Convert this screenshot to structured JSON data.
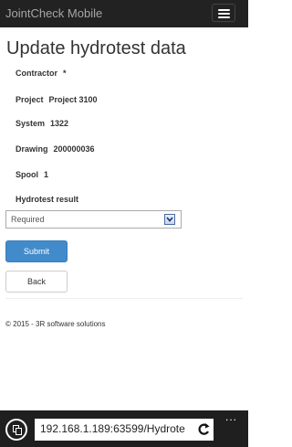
{
  "app": {
    "brand": "JointCheck Mobile"
  },
  "page": {
    "title": "Update hydrotest data"
  },
  "fields": {
    "contractor": {
      "label": "Contractor",
      "value": "*"
    },
    "project": {
      "label": "Project",
      "value": "Project 3100"
    },
    "system": {
      "label": "System",
      "value": "1322"
    },
    "drawing": {
      "label": "Drawing",
      "value": "200000036"
    },
    "spool": {
      "label": "Spool",
      "value": "1"
    },
    "result": {
      "label": "Hydrotest result"
    }
  },
  "select": {
    "selected": "Required"
  },
  "buttons": {
    "submit": "Submit",
    "back": "Back"
  },
  "footer": {
    "text": "© 2015 - 3R software solutions"
  },
  "browser": {
    "url": "192.168.1.189:63599/Hydrote",
    "more": "..."
  },
  "colors": {
    "navbar": "#222222",
    "primary": "#428bca"
  },
  "icons": {
    "menu": "hamburger-icon",
    "dropdown": "chevron-down-icon",
    "tabs": "tabs-icon",
    "refresh": "refresh-icon"
  }
}
